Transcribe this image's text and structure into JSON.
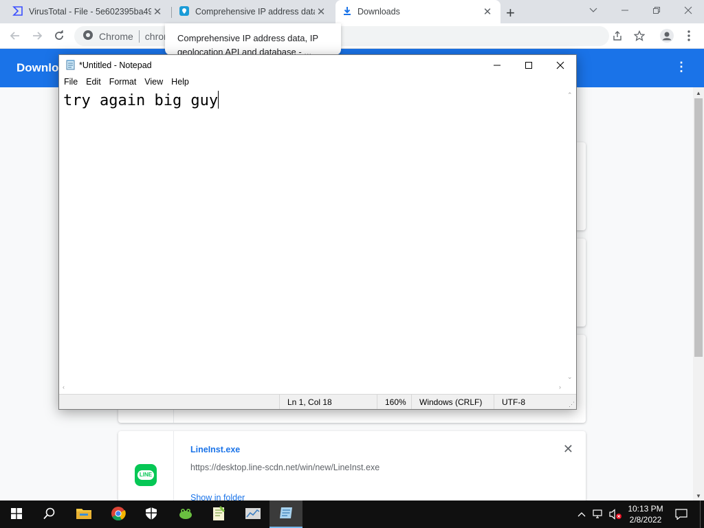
{
  "browser": {
    "tabs": [
      {
        "title": "VirusTotal - File - 5e602395ba49f",
        "icon": "virustotal-icon",
        "active": false
      },
      {
        "title": "Comprehensive IP address data, I",
        "icon": "location-pin-icon",
        "active": false
      },
      {
        "title": "Downloads",
        "icon": "download-icon",
        "active": true
      }
    ],
    "new_tab_label": "+",
    "omnibox": {
      "site_label": "Chrome",
      "url_text": "chrome"
    },
    "hover_card": {
      "title": "Comprehensive IP address data, IP geolocation API and database - ..."
    },
    "downloads_title": "Downloads",
    "download_item": {
      "file_name": "LineInst.exe",
      "url": "https://desktop.line-scdn.net/win/new/LineInst.exe",
      "action": "Show in folder",
      "remove_label": "✕",
      "logo_text": "LINE"
    }
  },
  "notepad": {
    "title": "*Untitled - Notepad",
    "menu": [
      "File",
      "Edit",
      "Format",
      "View",
      "Help"
    ],
    "content": "try again big guy",
    "status": {
      "position": "Ln 1, Col 18",
      "zoom": "160%",
      "line_ending": "Windows (CRLF)",
      "encoding": "UTF-8"
    }
  },
  "taskbar": {
    "apps": [
      "start-icon",
      "search-icon",
      "file-explorer-icon",
      "chrome-icon",
      "windows-security-icon",
      "frog-app-icon",
      "notepadpp-icon",
      "chart-app-icon",
      "notepad-icon"
    ],
    "clock": {
      "time": "10:13 PM",
      "date": "2/8/2022"
    }
  },
  "colors": {
    "chrome_accent": "#1a73e8",
    "taskbar_bg": "#101010",
    "line_green": "#06c755"
  }
}
